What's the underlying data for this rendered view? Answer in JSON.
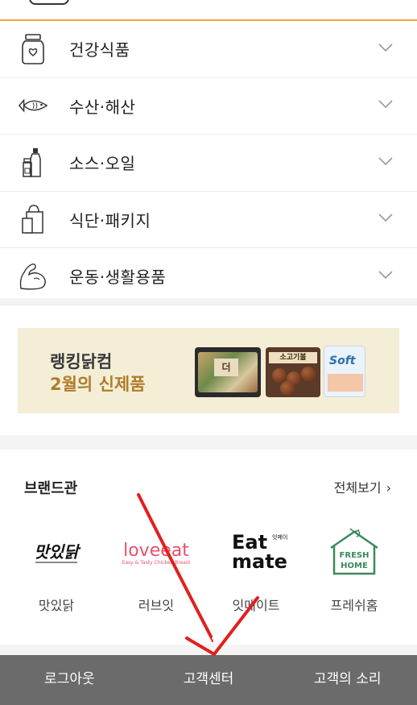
{
  "categories": [
    {
      "label": "건강식품",
      "icon": "jar-icon"
    },
    {
      "label": "수산·해산",
      "icon": "fish-icon"
    },
    {
      "label": "소스·오일",
      "icon": "bottles-icon"
    },
    {
      "label": "식단·패키지",
      "icon": "shopping-bag-icon"
    },
    {
      "label": "운동·생활용품",
      "icon": "muscle-arm-icon"
    }
  ],
  "banner": {
    "title": "랭킹닭컴",
    "subtitle": "2월의 신제품",
    "products": [
      {
        "tag": "더"
      },
      {
        "label": "소고기볼"
      },
      {
        "label": "Soft"
      }
    ]
  },
  "brands": {
    "heading": "브랜드관",
    "view_all": "전체보기",
    "items": [
      {
        "name": "맛있닭",
        "logo_text": "맛있닭"
      },
      {
        "name": "러브잇",
        "logo_text": "loveeat",
        "logo_sub": "Easy & Tasty Chicken Breast"
      },
      {
        "name": "잇메이트",
        "logo_text": "Eat mate",
        "logo_sub": "잇메이트"
      },
      {
        "name": "프레쉬홈",
        "logo_text": "FRESH HOME"
      }
    ]
  },
  "bottom_bar": {
    "logout": "로그아웃",
    "customer_center": "고객센터",
    "customer_voice": "고객의 소리"
  },
  "colors": {
    "accent_orange": "#f3a24a",
    "banner_bg": "#f4eed7",
    "banner_sub": "#b07c2b",
    "bottom_bar": "#6b6b6b",
    "annotation_red": "#e02020",
    "loveeat_pink": "#e8506a",
    "freshhome_green": "#3a8a5a"
  }
}
